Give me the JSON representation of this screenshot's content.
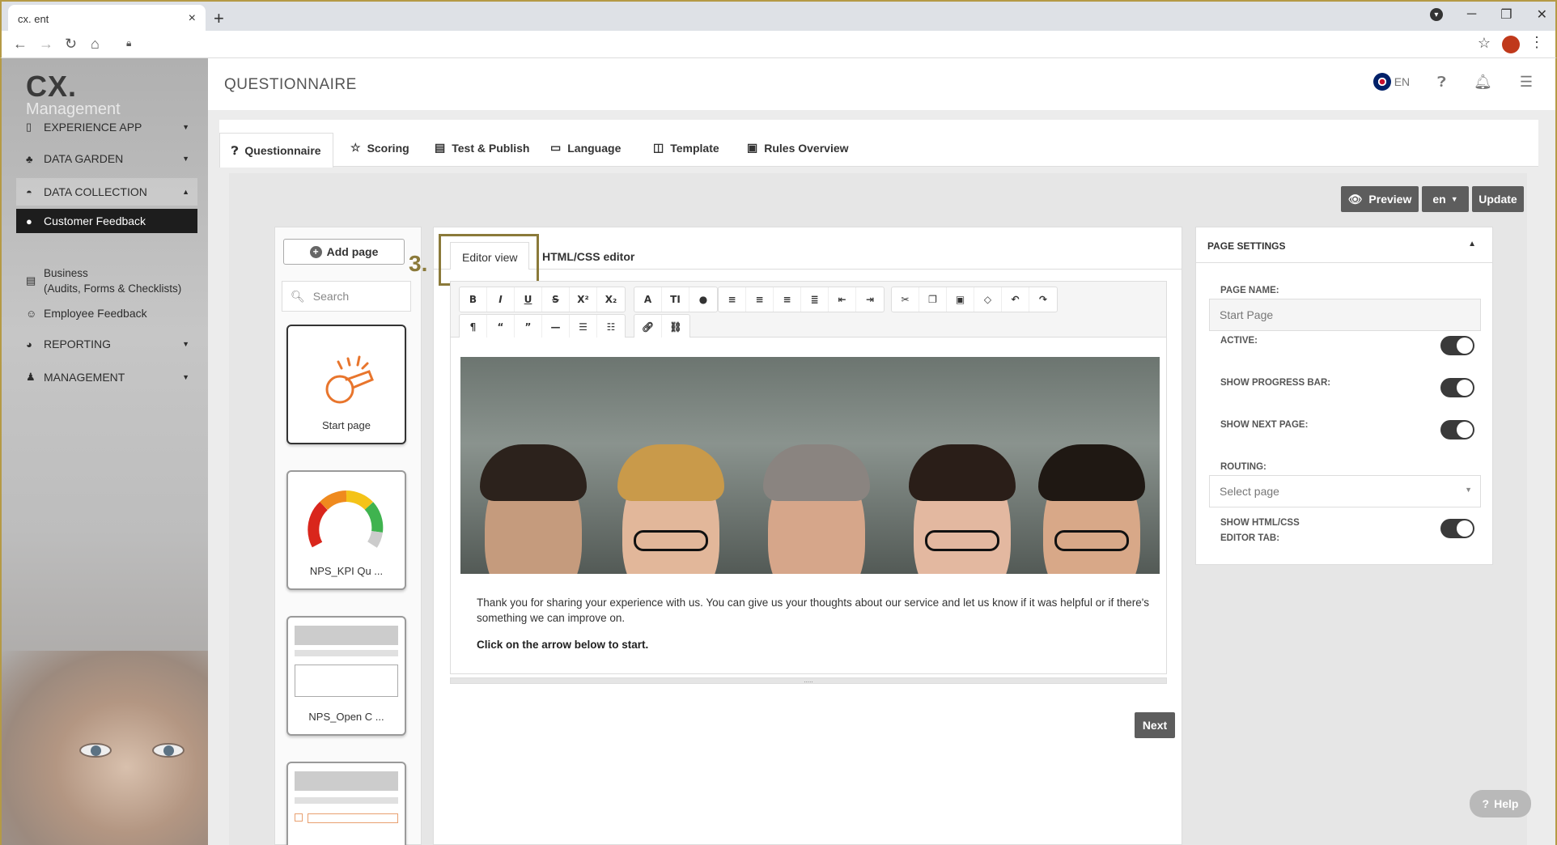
{
  "browser": {
    "tab_title": "cx.              ent",
    "new_tab": "+",
    "tab_close": "×"
  },
  "app": {
    "logo_main": "CX.",
    "logo_sub": "Management",
    "page_title": "QUESTIONNAIRE",
    "language": "EN"
  },
  "sidebar": {
    "items": [
      {
        "label": "EXPERIENCE APP",
        "icon": "phone-icon"
      },
      {
        "label": "DATA GARDEN",
        "icon": "tree-icon"
      },
      {
        "label": "DATA COLLECTION",
        "icon": "inbox-icon"
      },
      {
        "label": "Customer Feedback",
        "icon": "comments-icon"
      },
      {
        "label": "Business\n(Audits, Forms & Checklists)",
        "icon": "briefcase-icon"
      },
      {
        "label": "Employee Feedback",
        "icon": "users-icon"
      },
      {
        "label": "REPORTING",
        "icon": "chart-icon"
      },
      {
        "label": "MANAGEMENT",
        "icon": "user-icon"
      }
    ]
  },
  "tabs": [
    {
      "label": "Questionnaire"
    },
    {
      "label": "Scoring"
    },
    {
      "label": "Test & Publish"
    },
    {
      "label": "Language"
    },
    {
      "label": "Template"
    },
    {
      "label": "Rules Overview"
    }
  ],
  "actions": {
    "preview": "Preview",
    "lang_select": "en",
    "update": "Update",
    "next": "Next",
    "help": "Help"
  },
  "pages_panel": {
    "add_page": "Add page",
    "search_placeholder": "Search",
    "pages": [
      "Start page",
      "NPS_KPI Qu ...",
      "NPS_Open C ..."
    ]
  },
  "editor": {
    "step_number": "3.",
    "tab_editor": "Editor view",
    "tab_html": "HTML/CSS editor",
    "intro_text": "Thank you for sharing your experience with us. You can give us your thoughts about our service and let us know if it was helpful or if there's something we can improve on.",
    "cta_text": "Click on the arrow below to start.",
    "resize_handle": "....."
  },
  "page_settings": {
    "title": "PAGE SETTINGS",
    "page_name_label": "PAGE NAME:",
    "page_name_placeholder": "Start Page",
    "active_label": "ACTIVE:",
    "progress_label": "SHOW PROGRESS BAR:",
    "next_page_label": "SHOW NEXT PAGE:",
    "routing_label": "ROUTING:",
    "routing_placeholder": "Select page",
    "html_tab_label_1": "SHOW HTML/CSS",
    "html_tab_label_2": "EDITOR TAB:",
    "active": true,
    "show_progress": true,
    "show_next": true,
    "show_html_tab": true
  },
  "colors": {
    "accent_border": "#b59a45",
    "highlight": "#8b7a3a",
    "dark_button": "#5d5d5d",
    "active_nav": "#1d1d1d"
  }
}
